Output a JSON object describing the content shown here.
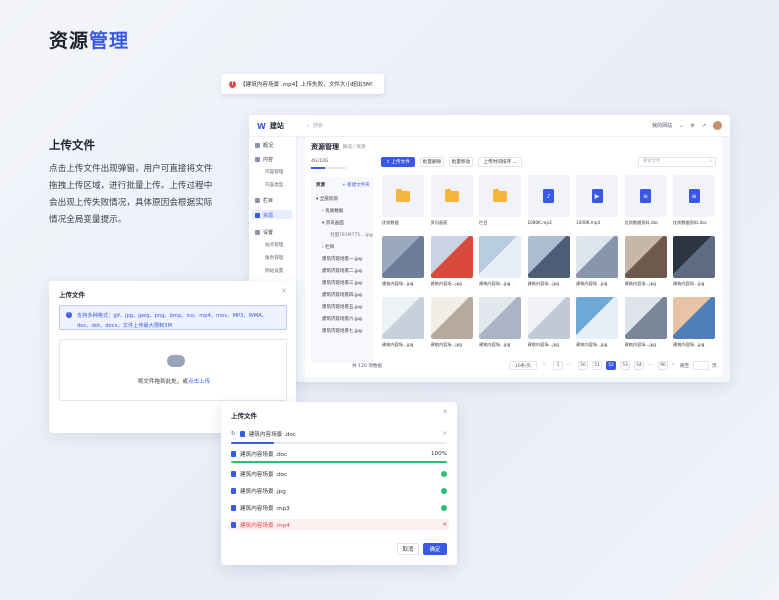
{
  "page_title_a": "资源",
  "page_title_b": "管理",
  "section": {
    "heading": "上传文件",
    "desc": "点击上传文件出现弹窗，用户可直接将文件拖拽上传区域，进行批量上传。上传过程中会出现上传失败情况，具体原因会根据实际情况全局变量提示。"
  },
  "toast": {
    "text": "【建筑内容场景 .mp4】上传失败，文件大小超出3M!"
  },
  "app": {
    "brand": "建站",
    "search_placeholder": "搜索",
    "top_right": "我的网站",
    "sidebar": {
      "overview": "概况",
      "content": "内容",
      "content_mgmt": "内容管理",
      "content_cat": "内容类型",
      "column": "栏目",
      "resource": "资源",
      "settings": "设置",
      "site_settings": "站点管理",
      "role_mgmt": "角色管理",
      "site_config": "网站设置"
    },
    "title": "资源管理",
    "breadcrumb": "概况 / 资源",
    "capacity": "4G/10G",
    "buttons": {
      "upload": "上传文件",
      "batch_delete": "批量删除",
      "batch_move": "批量移动",
      "sort": "上传时间排序"
    },
    "search_files": "搜索文件",
    "tree": {
      "header": "资源",
      "new_folder": "+ 新建文件夹",
      "all": "全部资源",
      "excellent": "优质数据",
      "material": "资讯画面",
      "file1": "封面783M775....jpg",
      "column": "栏目",
      "items": [
        "建筑内容场景一.jpg",
        "建筑内容场景二.jpg",
        "建筑内容场景三.jpg",
        "建筑内容场景四.jpg",
        "建筑内容场景五.jpg",
        "建筑内容场景六.jpg",
        "建筑内容场景七.jpg"
      ]
    },
    "grid": [
      [
        "优质数据",
        "资讯画面",
        "栏目",
        "1080K.mp3",
        "1000K.mp4",
        "优质数据资料.doc",
        "优质数据资料.doc"
      ],
      [
        "建筑内容场...jpg",
        "建筑内容场...jpg",
        "建筑内容场...jpg",
        "建筑内容场...jpg",
        "建筑内容场...jpg",
        "建筑内容场...jpg",
        "建筑内容场...jpg"
      ],
      [
        "建筑内容场...jpg",
        "建筑内容场...jpg",
        "建筑内容场...jpg",
        "建筑内容场...jpg",
        "建筑内容场...jpg",
        "建筑内容场...jpg",
        "建筑内容场...jpg"
      ]
    ],
    "pager": {
      "total": "共 120 项数据",
      "per": "10条/页",
      "p1": "1",
      "p50": "50",
      "p51": "51",
      "p52": "52",
      "p53": "53",
      "p54": "54",
      "p90": "90",
      "goto": "跳至",
      "page": "页"
    }
  },
  "modal1": {
    "title": "上传文件",
    "tip": "支持多种格式：gif、jpg、jpeg、png、bmp、ico、mp4、mov、MP3、WMA、doc、dot、docx，文件上传最大限制3M",
    "drop_text": "将文件拖到此处，或",
    "drop_link": "点击上传"
  },
  "modal2": {
    "title": "上传文件",
    "files": [
      {
        "name": "建筑内容场景 .doc",
        "state": "loading"
      },
      {
        "name": "建筑内容场景 .doc",
        "state": "progress",
        "pct": "100%"
      },
      {
        "name": "建筑内容场景 .doc",
        "state": "done"
      },
      {
        "name": "建筑内容场景 .jpg",
        "state": "done"
      },
      {
        "name": "建筑内容场景 .mp3",
        "state": "done"
      },
      {
        "name": "建筑内容场景 .mp4",
        "state": "error"
      }
    ],
    "cancel": "取消",
    "confirm": "确定"
  },
  "colors": {
    "accent": "#3a58e8",
    "success": "#2fbf71",
    "error": "#e5484d",
    "folder": "#f7b53c"
  }
}
